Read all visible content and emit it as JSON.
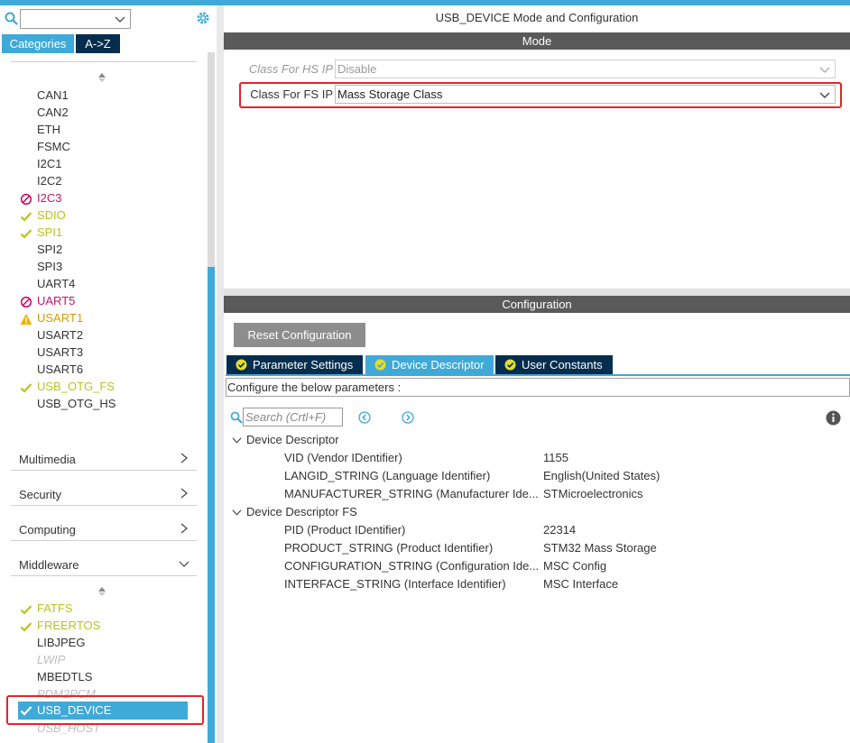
{
  "left": {
    "tabs": {
      "categories": "Categories",
      "az": "A->Z"
    },
    "peripherals": [
      {
        "label": "CAN1",
        "status": "none"
      },
      {
        "label": "CAN2",
        "status": "none"
      },
      {
        "label": "ETH",
        "status": "none"
      },
      {
        "label": "FSMC",
        "status": "none"
      },
      {
        "label": "I2C1",
        "status": "none"
      },
      {
        "label": "I2C2",
        "status": "none"
      },
      {
        "label": "I2C3",
        "status": "conflict"
      },
      {
        "label": "SDIO",
        "status": "ok"
      },
      {
        "label": "SPI1",
        "status": "ok"
      },
      {
        "label": "SPI2",
        "status": "none"
      },
      {
        "label": "SPI3",
        "status": "none"
      },
      {
        "label": "UART4",
        "status": "none"
      },
      {
        "label": "UART5",
        "status": "conflict"
      },
      {
        "label": "USART1",
        "status": "warning"
      },
      {
        "label": "USART2",
        "status": "none"
      },
      {
        "label": "USART3",
        "status": "none"
      },
      {
        "label": "USART6",
        "status": "none"
      },
      {
        "label": "USB_OTG_FS",
        "status": "ok"
      },
      {
        "label": "USB_OTG_HS",
        "status": "none"
      }
    ],
    "categories": [
      {
        "label": "Multimedia",
        "expanded": false
      },
      {
        "label": "Security",
        "expanded": false
      },
      {
        "label": "Computing",
        "expanded": false
      },
      {
        "label": "Middleware",
        "expanded": true
      }
    ],
    "middleware": [
      {
        "label": "FATFS",
        "status": "ok"
      },
      {
        "label": "FREERTOS",
        "status": "ok"
      },
      {
        "label": "LIBJPEG",
        "status": "none"
      },
      {
        "label": "LWIP",
        "status": "disabled"
      },
      {
        "label": "MBEDTLS",
        "status": "none"
      },
      {
        "label": "PDM2PCM",
        "status": "disabled"
      },
      {
        "label": "USB_DEVICE",
        "status": "ok",
        "selected": true
      },
      {
        "label": "USB_HOST",
        "status": "disabled"
      }
    ]
  },
  "right": {
    "title": "USB_DEVICE Mode and Configuration",
    "mode_header": "Mode",
    "mode_fields": [
      {
        "label": "Class For HS IP",
        "value": "Disable",
        "enabled": false
      },
      {
        "label": "Class For FS IP",
        "value": "Mass Storage Class",
        "enabled": true
      }
    ],
    "config_header": "Configuration",
    "reset_label": "Reset Configuration",
    "tabs": [
      {
        "label": "Parameter Settings",
        "active": false
      },
      {
        "label": "Device Descriptor",
        "active": true
      },
      {
        "label": "User Constants",
        "active": false
      }
    ],
    "configure_text": "Configure the below parameters :",
    "search_placeholder": "Search (Crtl+F)",
    "tree": [
      {
        "group": "Device Descriptor",
        "rows": [
          {
            "name": "VID (Vendor IDentifier)",
            "value": "1155"
          },
          {
            "name": "LANGID_STRING (Language Identifier)",
            "value": "English(United States)"
          },
          {
            "name": "MANUFACTURER_STRING (Manufacturer Ide...",
            "value": "STMicroelectronics"
          }
        ]
      },
      {
        "group": "Device Descriptor FS",
        "rows": [
          {
            "name": "PID (Product IDentifier)",
            "value": "22314"
          },
          {
            "name": "PRODUCT_STRING (Product Identifier)",
            "value": "STM32 Mass Storage"
          },
          {
            "name": "CONFIGURATION_STRING (Configuration Ide...",
            "value": "MSC Config"
          },
          {
            "name": "INTERFACE_STRING (Interface Identifier)",
            "value": "MSC Interface"
          }
        ]
      }
    ]
  },
  "colors": {
    "accent": "#3fa9d8",
    "dark_tab": "#052e4e",
    "section_header": "#5a5a5a",
    "ok": "#b8c51a",
    "conflict": "#c4166b",
    "warning": "#e8b400",
    "highlight_box": "#e0262a"
  }
}
